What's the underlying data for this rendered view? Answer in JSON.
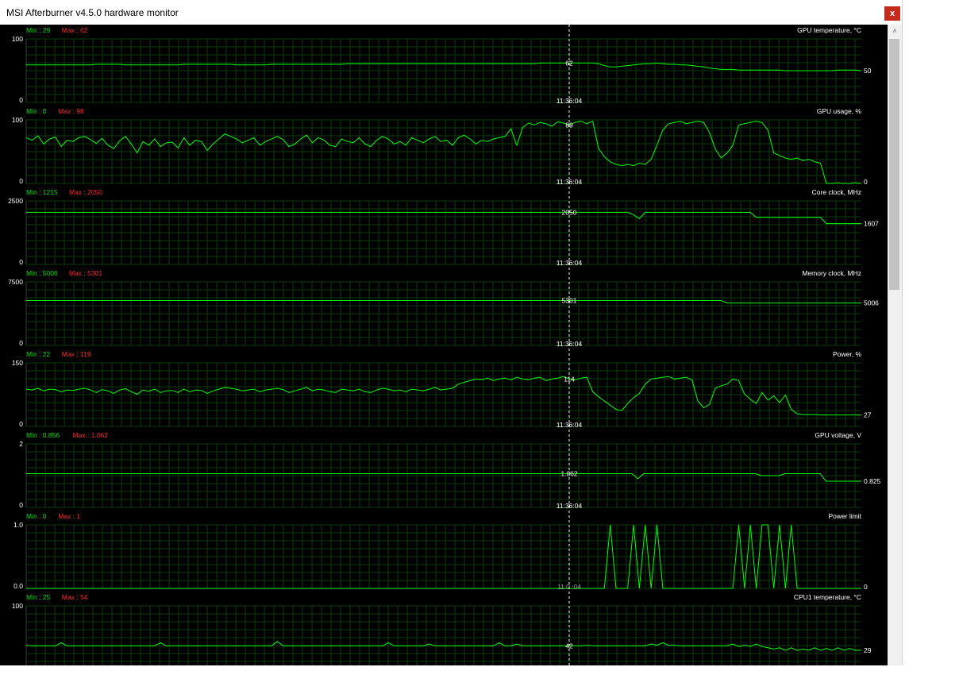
{
  "window": {
    "title": "MSI Afterburner v4.5.0 hardware monitor",
    "close_label": "x"
  },
  "scrollbar": {
    "up_arrow": "˄"
  },
  "colors": {
    "background": "#000000",
    "grid": "#0b3d0b",
    "line": "#00ff00",
    "min": "#00e000",
    "max": "#ff2020",
    "text": "#ffffff"
  },
  "time_marker": "11:36:04",
  "panels": [
    {
      "name": "GPU temperature, °C",
      "ymax_label": "100",
      "ymin_label": "0",
      "ymin": 0,
      "ymax": 100,
      "min_text": "Min : 29",
      "max_text": "Max : 62",
      "cursor_value": "62",
      "current_value": "50",
      "time_label": "11:36:04",
      "values": [
        59,
        59,
        59,
        59,
        59,
        59,
        59,
        59,
        59,
        59,
        59,
        59,
        60,
        60,
        60,
        60,
        60,
        59,
        59,
        59,
        59,
        59,
        59,
        59,
        59,
        59,
        59,
        60,
        60,
        60,
        60,
        60,
        60,
        60,
        60,
        60,
        59,
        59,
        59,
        59,
        59,
        59,
        60,
        60,
        60,
        60,
        60,
        60,
        60,
        60,
        60,
        60,
        60,
        60,
        60,
        61,
        61,
        61,
        61,
        61,
        61,
        61,
        61,
        61,
        61,
        61,
        61,
        61,
        61,
        61,
        61,
        61,
        61,
        61,
        61,
        61,
        61,
        61,
        61,
        61,
        61,
        61,
        61,
        61,
        61,
        61,
        61,
        61,
        62,
        62,
        62,
        62,
        62,
        62,
        62,
        62,
        62,
        62,
        61,
        58,
        56,
        56,
        57,
        58,
        59,
        60,
        61,
        61,
        62,
        61,
        60,
        60,
        59,
        59,
        58,
        57,
        56,
        54,
        53,
        52,
        52,
        52,
        51,
        51,
        51,
        51,
        51,
        51,
        51,
        51,
        50,
        50,
        50,
        50,
        50,
        50,
        50,
        50,
        50,
        51,
        51,
        51,
        51,
        50
      ]
    },
    {
      "name": "GPU usage, %",
      "ymax_label": "100",
      "ymin_label": "0",
      "ymin": 0,
      "ymax": 100,
      "min_text": "Min : 0",
      "max_text": "Max : 98",
      "cursor_value": "89",
      "current_value": "0",
      "time_label": "11:36:04",
      "values": [
        72,
        68,
        75,
        62,
        70,
        73,
        58,
        68,
        66,
        72,
        74,
        69,
        63,
        71,
        60,
        55,
        67,
        74,
        62,
        48,
        66,
        60,
        70,
        58,
        64,
        65,
        56,
        72,
        60,
        68,
        66,
        52,
        62,
        70,
        78,
        74,
        70,
        64,
        68,
        72,
        60,
        66,
        70,
        74,
        69,
        58,
        62,
        70,
        76,
        64,
        72,
        68,
        60,
        58,
        70,
        66,
        64,
        72,
        62,
        58,
        68,
        74,
        70,
        62,
        66,
        60,
        72,
        68,
        64,
        70,
        74,
        66,
        68,
        60,
        72,
        76,
        70,
        62,
        68,
        66,
        70,
        72,
        74,
        86,
        60,
        88,
        95,
        92,
        96,
        94,
        90,
        97,
        95,
        92,
        96,
        98,
        94,
        98,
        55,
        42,
        34,
        30,
        28,
        30,
        28,
        32,
        30,
        38,
        60,
        84,
        94,
        96,
        98,
        94,
        96,
        98,
        96,
        80,
        54,
        40,
        48,
        60,
        92,
        94,
        96,
        98,
        96,
        84,
        48,
        44,
        40,
        38,
        40,
        36,
        38,
        34,
        32,
        0,
        0,
        1,
        0,
        0,
        1,
        0
      ]
    },
    {
      "name": "Core clock, MHz",
      "ymax_label": "2500",
      "ymin_label": "0",
      "ymin": 0,
      "ymax": 2500,
      "min_text": "Min : 1215",
      "max_text": "Max : 2050",
      "cursor_value": "2050",
      "current_value": "1607",
      "time_label": "11:36:04",
      "values": [
        2050,
        2050,
        2050,
        2050,
        2050,
        2050,
        2050,
        2050,
        2050,
        2050,
        2050,
        2050,
        2050,
        2050,
        2050,
        2050,
        2050,
        2050,
        2050,
        2050,
        2050,
        2050,
        2050,
        2050,
        2050,
        2050,
        2050,
        2050,
        2050,
        2050,
        2050,
        2050,
        2050,
        2050,
        2050,
        2050,
        2050,
        2050,
        2050,
        2050,
        2050,
        2050,
        2050,
        2050,
        2050,
        2050,
        2050,
        2050,
        2050,
        2050,
        2050,
        2050,
        2050,
        2050,
        2050,
        2050,
        2050,
        2050,
        2050,
        2050,
        2050,
        2050,
        2050,
        2050,
        2050,
        2050,
        2050,
        2050,
        2050,
        2050,
        2050,
        2050,
        2050,
        2050,
        2050,
        2050,
        2050,
        2050,
        2050,
        2050,
        2050,
        2050,
        2050,
        2050,
        2050,
        2050,
        2050,
        2050,
        2050,
        2050,
        2050,
        2050,
        2050,
        2050,
        2050,
        2050,
        2050,
        2050,
        2050,
        2050,
        2050,
        2050,
        2050,
        2050,
        1950,
        1800,
        2050,
        2050,
        2050,
        2050,
        2050,
        2050,
        2050,
        2050,
        2050,
        2050,
        2050,
        2050,
        2050,
        2050,
        2050,
        2050,
        2050,
        2050,
        2050,
        1850,
        1850,
        1850,
        1850,
        1850,
        1850,
        1850,
        1850,
        1850,
        1850,
        1850,
        1850,
        1607,
        1607,
        1607,
        1607,
        1607,
        1607,
        1607
      ]
    },
    {
      "name": "Memory clock, MHz",
      "ymax_label": "7500",
      "ymin_label": "0",
      "ymin": 0,
      "ymax": 7500,
      "min_text": "Min : 5006",
      "max_text": "Max : 5301",
      "cursor_value": "5301",
      "current_value": "5006",
      "time_label": "11:36:04",
      "values": [
        5301,
        5301,
        5301,
        5301,
        5301,
        5301,
        5301,
        5301,
        5301,
        5301,
        5301,
        5301,
        5301,
        5301,
        5301,
        5301,
        5301,
        5301,
        5301,
        5301,
        5301,
        5301,
        5301,
        5301,
        5301,
        5301,
        5301,
        5301,
        5301,
        5301,
        5301,
        5301,
        5301,
        5301,
        5301,
        5301,
        5301,
        5301,
        5301,
        5301,
        5301,
        5301,
        5301,
        5301,
        5301,
        5301,
        5301,
        5301,
        5301,
        5301,
        5301,
        5301,
        5301,
        5301,
        5301,
        5301,
        5301,
        5301,
        5301,
        5301,
        5301,
        5301,
        5301,
        5301,
        5301,
        5301,
        5301,
        5301,
        5301,
        5301,
        5301,
        5301,
        5301,
        5301,
        5301,
        5301,
        5301,
        5301,
        5301,
        5301,
        5301,
        5301,
        5301,
        5301,
        5301,
        5301,
        5301,
        5301,
        5301,
        5301,
        5301,
        5301,
        5301,
        5301,
        5301,
        5301,
        5301,
        5301,
        5301,
        5301,
        5301,
        5301,
        5301,
        5301,
        5301,
        5301,
        5301,
        5301,
        5301,
        5301,
        5301,
        5301,
        5301,
        5301,
        5301,
        5301,
        5301,
        5301,
        5301,
        5301,
        5006,
        5006,
        5006,
        5006,
        5006,
        5006,
        5006,
        5006,
        5006,
        5006,
        5006,
        5006,
        5006,
        5006,
        5006,
        5006,
        5006,
        5006,
        5006,
        5006,
        5006,
        5006,
        5006,
        5006
      ]
    },
    {
      "name": "Power, %",
      "ymax_label": "150",
      "ymin_label": "0",
      "ymin": 0,
      "ymax": 150,
      "min_text": "Min : 22",
      "max_text": "Max : 119",
      "cursor_value": "114",
      "current_value": "27",
      "time_label": "11:36:04",
      "values": [
        88,
        86,
        90,
        84,
        88,
        87,
        82,
        86,
        85,
        88,
        90,
        86,
        80,
        87,
        84,
        78,
        86,
        89,
        82,
        76,
        86,
        83,
        88,
        80,
        84,
        85,
        80,
        88,
        82,
        86,
        85,
        78,
        84,
        88,
        92,
        90,
        88,
        84,
        86,
        88,
        82,
        86,
        88,
        90,
        87,
        80,
        84,
        88,
        92,
        84,
        88,
        86,
        82,
        80,
        88,
        86,
        84,
        88,
        82,
        80,
        86,
        90,
        88,
        84,
        86,
        82,
        88,
        86,
        84,
        88,
        92,
        86,
        88,
        90,
        100,
        104,
        108,
        112,
        110,
        114,
        108,
        112,
        114,
        110,
        116,
        112,
        110,
        114,
        116,
        108,
        112,
        114,
        118,
        112,
        110,
        114,
        116,
        82,
        70,
        60,
        50,
        40,
        38,
        54,
        68,
        78,
        100,
        112,
        114,
        116,
        118,
        112,
        114,
        116,
        110,
        60,
        44,
        52,
        90,
        96,
        100,
        112,
        108,
        76,
        64,
        54,
        80,
        62,
        72,
        56,
        74,
        40,
        30,
        28,
        28,
        28,
        27,
        27,
        27,
        27,
        27,
        27,
        27,
        27
      ]
    },
    {
      "name": "GPU voltage, V",
      "ymax_label": "2",
      "ymin_label": "0",
      "ymin": 0,
      "ymax": 2,
      "min_text": "Min : 0.856",
      "max_text": "Max : 1.062",
      "cursor_value": "1.062",
      "current_value": "0.825",
      "time_label": "11:36:04",
      "values": [
        1.062,
        1.062,
        1.062,
        1.062,
        1.062,
        1.062,
        1.062,
        1.062,
        1.062,
        1.062,
        1.062,
        1.062,
        1.062,
        1.062,
        1.062,
        1.062,
        1.062,
        1.062,
        1.062,
        1.062,
        1.062,
        1.062,
        1.062,
        1.062,
        1.062,
        1.062,
        1.062,
        1.062,
        1.062,
        1.062,
        1.062,
        1.062,
        1.062,
        1.062,
        1.062,
        1.062,
        1.062,
        1.062,
        1.062,
        1.062,
        1.062,
        1.062,
        1.062,
        1.062,
        1.062,
        1.062,
        1.062,
        1.062,
        1.062,
        1.062,
        1.062,
        1.062,
        1.062,
        1.062,
        1.062,
        1.062,
        1.062,
        1.062,
        1.062,
        1.062,
        1.062,
        1.062,
        1.062,
        1.062,
        1.062,
        1.062,
        1.062,
        1.062,
        1.062,
        1.062,
        1.062,
        1.062,
        1.062,
        1.062,
        1.062,
        1.062,
        1.062,
        1.062,
        1.062,
        1.062,
        1.062,
        1.062,
        1.062,
        1.062,
        1.062,
        1.062,
        1.062,
        1.062,
        1.062,
        1.062,
        1.062,
        1.062,
        1.062,
        1.062,
        1.062,
        1.062,
        1.062,
        1.062,
        1.062,
        1.062,
        1.062,
        1.062,
        1.062,
        1.062,
        0.9,
        1.062,
        1.062,
        1.062,
        1.062,
        1.062,
        1.062,
        1.062,
        1.062,
        1.062,
        1.062,
        1.062,
        1.062,
        1.062,
        1.062,
        1.062,
        1.062,
        1.062,
        1.062,
        1.062,
        1.062,
        1.0,
        1.0,
        1.0,
        1.0,
        1.062,
        1.062,
        1.062,
        1.062,
        1.062,
        1.062,
        1.062,
        0.825,
        0.825,
        0.825,
        0.825,
        0.825,
        0.825,
        0.825
      ]
    },
    {
      "name": "Power limit",
      "ymax_label": "1.0",
      "ymin_label": "0.0",
      "ymin": 0,
      "ymax": 1,
      "min_text": "Min : 0",
      "max_text": "Max : 1",
      "cursor_value": "",
      "current_value": "0",
      "time_label": "11:0 :04",
      "values": [
        0,
        0,
        0,
        0,
        0,
        0,
        0,
        0,
        0,
        0,
        0,
        0,
        0,
        0,
        0,
        0,
        0,
        0,
        0,
        0,
        0,
        0,
        0,
        0,
        0,
        0,
        0,
        0,
        0,
        0,
        0,
        0,
        0,
        0,
        0,
        0,
        0,
        0,
        0,
        0,
        0,
        0,
        0,
        0,
        0,
        0,
        0,
        0,
        0,
        0,
        0,
        0,
        0,
        0,
        0,
        0,
        0,
        0,
        0,
        0,
        0,
        0,
        0,
        0,
        0,
        0,
        0,
        0,
        0,
        0,
        0,
        0,
        0,
        0,
        0,
        0,
        0,
        0,
        0,
        0,
        0,
        0,
        0,
        0,
        0,
        0,
        0,
        0,
        0,
        0,
        0,
        0,
        0,
        0,
        0,
        0,
        0,
        0,
        0,
        0,
        1,
        0,
        0,
        0,
        1,
        0,
        1,
        0,
        1,
        0,
        0,
        0,
        0,
        0,
        0,
        0,
        0,
        0,
        0,
        0,
        0,
        0,
        1,
        0,
        1,
        0,
        1,
        1,
        0,
        1,
        0,
        1,
        0,
        0,
        0,
        0,
        0,
        0,
        0,
        0,
        0,
        0,
        0,
        0
      ]
    },
    {
      "name": "CPU1 temperature, °C",
      "ymax_label": "100",
      "ymin_label": "",
      "ymin": 0,
      "ymax": 100,
      "min_text": "Min : 25",
      "max_text": "Max : 54",
      "cursor_value": "42",
      "current_value": "29",
      "time_label": "",
      "values": [
        38,
        37,
        37,
        37,
        37,
        37,
        42,
        37,
        37,
        37,
        37,
        37,
        37,
        37,
        37,
        37,
        37,
        37,
        37,
        37,
        37,
        37,
        37,
        42,
        37,
        37,
        37,
        37,
        37,
        37,
        37,
        37,
        37,
        37,
        37,
        37,
        37,
        37,
        37,
        37,
        37,
        37,
        37,
        44,
        37,
        37,
        37,
        37,
        37,
        37,
        37,
        37,
        37,
        37,
        37,
        37,
        37,
        37,
        37,
        37,
        37,
        37,
        42,
        37,
        37,
        37,
        37,
        37,
        37,
        40,
        37,
        37,
        37,
        37,
        37,
        37,
        37,
        37,
        37,
        37,
        37,
        42,
        37,
        37,
        40,
        37,
        37,
        37,
        37,
        37,
        37,
        37,
        37,
        37,
        37,
        37,
        38,
        37,
        37,
        37,
        37,
        37,
        37,
        37,
        37,
        37,
        37,
        40,
        38,
        42,
        38,
        38,
        37,
        37,
        37,
        37,
        37,
        37,
        37,
        37,
        37,
        40,
        36,
        38,
        36,
        40,
        36,
        34,
        32,
        34,
        30,
        34,
        30,
        32,
        30,
        34,
        30,
        33,
        30,
        34,
        30,
        33,
        30,
        30
      ]
    }
  ]
}
